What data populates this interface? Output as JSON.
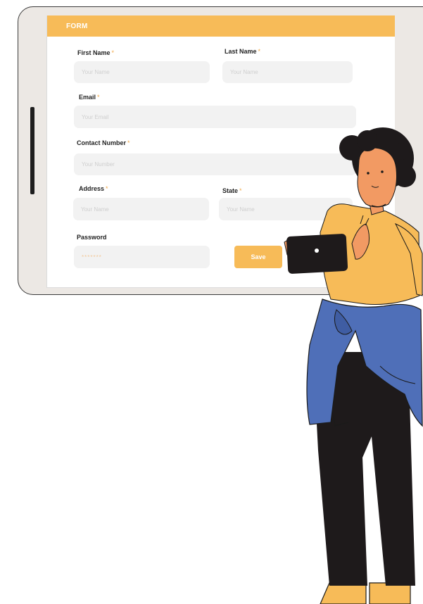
{
  "form": {
    "title": "FORM",
    "first_name": {
      "label": "First Name",
      "required": "*",
      "placeholder": "Your Name"
    },
    "last_name": {
      "label": "Last Name",
      "required": "*",
      "placeholder": "Your Name"
    },
    "email": {
      "label": "Email",
      "required": "*",
      "placeholder": "Your Email"
    },
    "contact": {
      "label": "Contact Number",
      "required": "*",
      "placeholder": "Your Number"
    },
    "address": {
      "label": "Address",
      "required": "*",
      "placeholder": "Your Name"
    },
    "state": {
      "label": "State",
      "required": "*",
      "placeholder": "Your Name"
    },
    "password": {
      "label": "Password",
      "placeholder": "*******"
    },
    "save_label": "Save"
  },
  "colors": {
    "accent": "#f7bb58",
    "input_bg": "#f2f2f2",
    "tablet_frame": "#ece8e4"
  }
}
